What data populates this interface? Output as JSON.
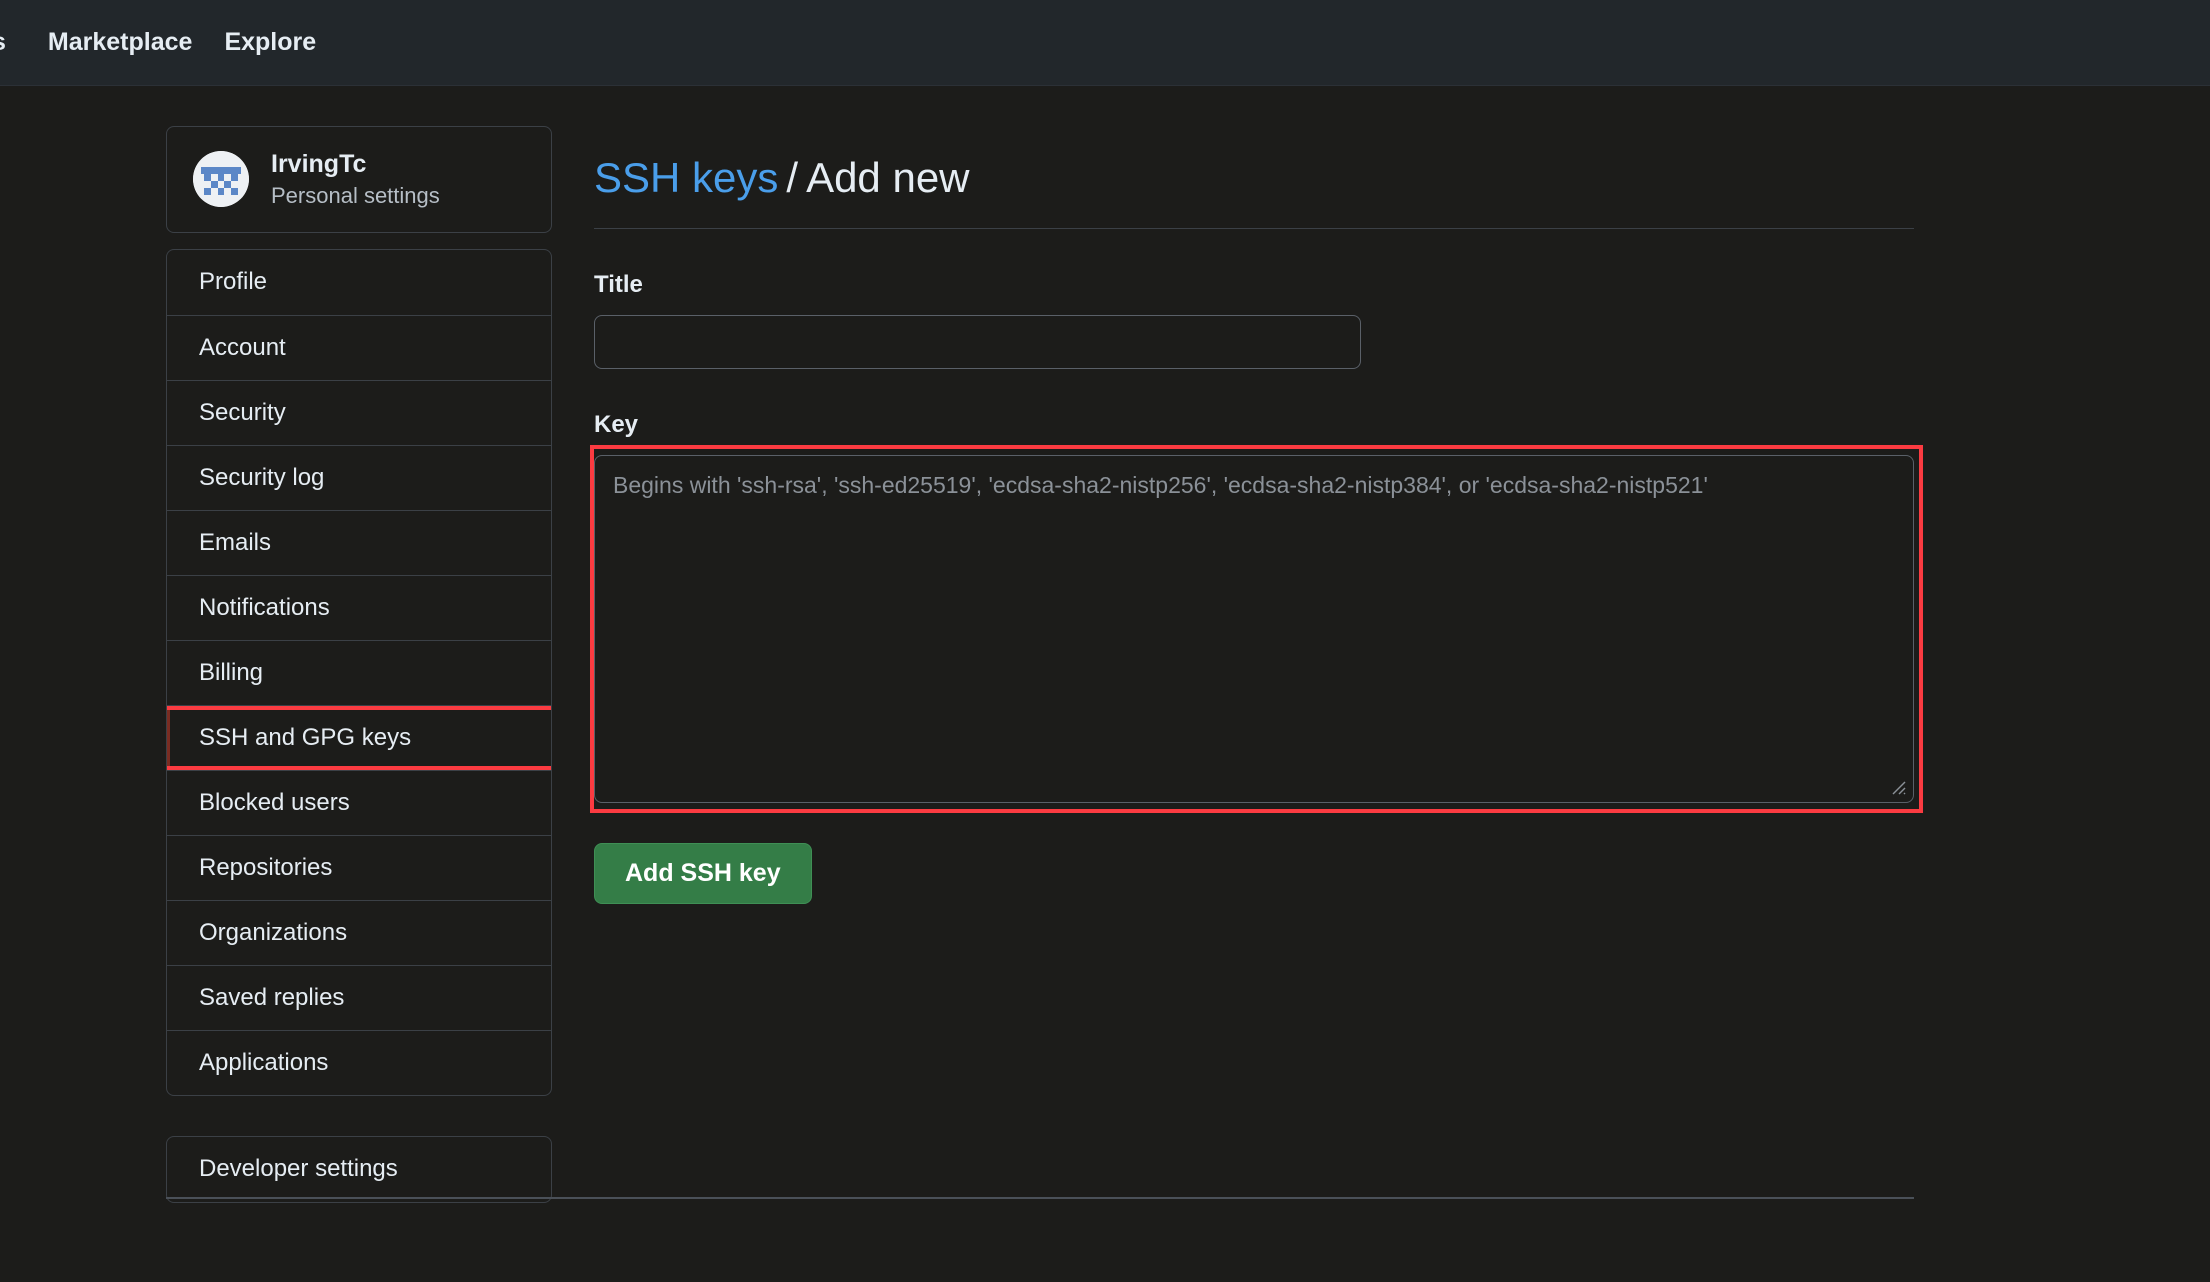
{
  "topbar": {
    "truncated_fragment": "s",
    "links": [
      {
        "label": "Marketplace"
      },
      {
        "label": "Explore"
      }
    ]
  },
  "sidebar": {
    "profile": {
      "name": "IrvingTc",
      "subtitle": "Personal settings",
      "avatar_icon": "identicon-avatar"
    },
    "items": [
      {
        "label": "Profile",
        "selected": false
      },
      {
        "label": "Account",
        "selected": false
      },
      {
        "label": "Security",
        "selected": false
      },
      {
        "label": "Security log",
        "selected": false
      },
      {
        "label": "Emails",
        "selected": false
      },
      {
        "label": "Notifications",
        "selected": false
      },
      {
        "label": "Billing",
        "selected": false
      },
      {
        "label": "SSH and GPG keys",
        "selected": true
      },
      {
        "label": "Blocked users",
        "selected": false
      },
      {
        "label": "Repositories",
        "selected": false
      },
      {
        "label": "Organizations",
        "selected": false
      },
      {
        "label": "Saved replies",
        "selected": false
      },
      {
        "label": "Applications",
        "selected": false
      }
    ],
    "developer_settings": {
      "label": "Developer settings"
    }
  },
  "main": {
    "heading": {
      "link_label": "SSH keys",
      "separator": "/",
      "current": "Add new"
    },
    "title_field": {
      "label": "Title",
      "value": "",
      "placeholder": ""
    },
    "key_field": {
      "label": "Key",
      "value": "",
      "placeholder": "Begins with 'ssh-rsa', 'ssh-ed25519', 'ecdsa-sha2-nistp256', 'ecdsa-sha2-nistp384', or 'ecdsa-sha2-nistp521'"
    },
    "submit_button": {
      "label": "Add SSH key"
    }
  },
  "colors": {
    "page_background": "#1c1c1a",
    "header_background": "#22272b",
    "border": "#3b4046",
    "link_blue": "#4a9eea",
    "button_green": "#347d47",
    "annotation_red": "#fb3b41",
    "text_primary": "#e6edf3",
    "text_muted": "#8b9198"
  }
}
